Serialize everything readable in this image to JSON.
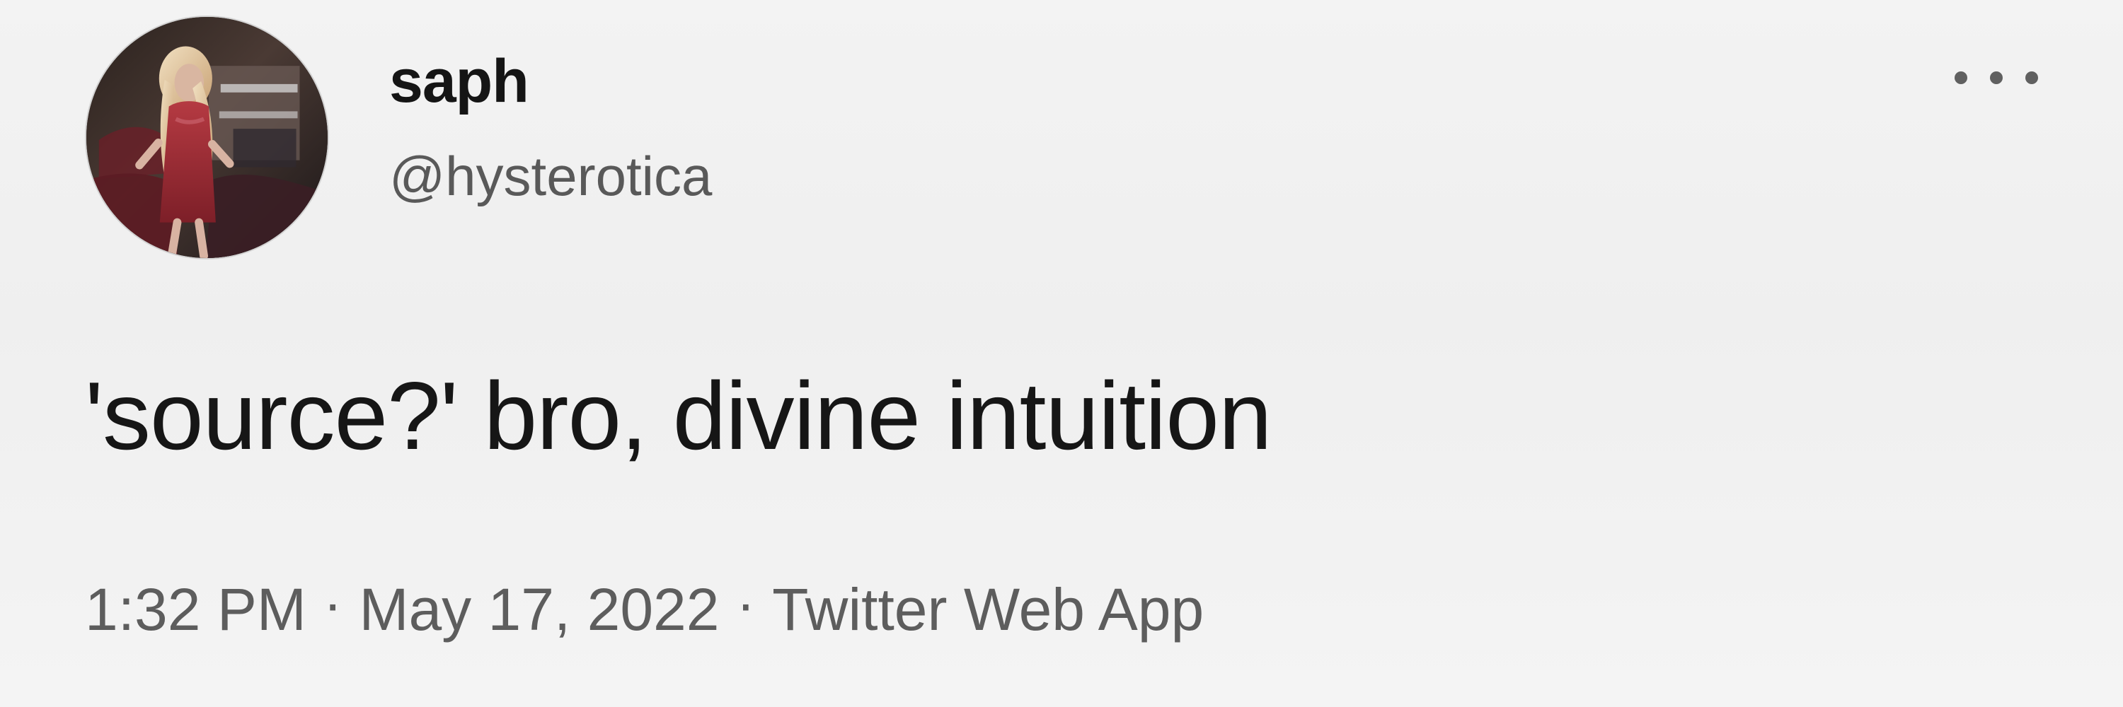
{
  "tweet": {
    "display_name": "saph",
    "handle": "@hysterotica",
    "text": "'source?' bro, divine intuition",
    "time": "1:32 PM",
    "separator": "·",
    "date": "May 17, 2022",
    "source": "Twitter Web App",
    "more_icon": "more-horizontal-icon"
  },
  "colors": {
    "background": "#efefef",
    "name_text": "#151515",
    "secondary_text": "#5d5d5d",
    "tweet_text": "#161616"
  }
}
